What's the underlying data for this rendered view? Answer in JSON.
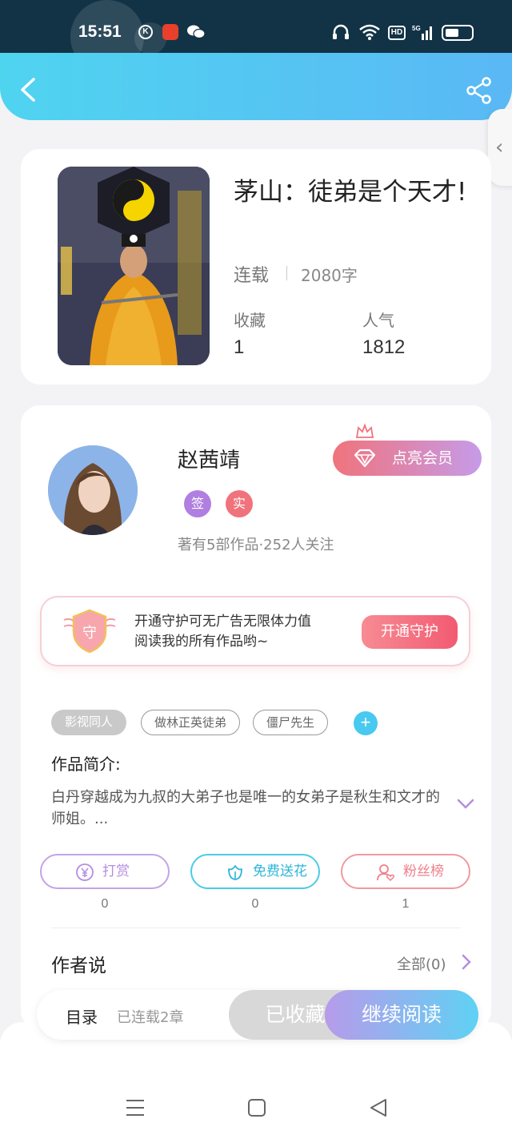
{
  "status_bar": {
    "time": "15:51",
    "k_badge": "K",
    "hd_label": "HD",
    "signal_label": "5G"
  },
  "book": {
    "title": "茅山：徒弟是个天才!",
    "status": "连载",
    "words": "2080字",
    "stats": [
      {
        "label": "收藏",
        "value": "1"
      },
      {
        "label": "人气",
        "value": "1812"
      }
    ]
  },
  "author": {
    "name": "赵茜靖",
    "badges": [
      "签",
      "实"
    ],
    "meta": "著有5部作品·252人关注",
    "vip_button": "点亮会员"
  },
  "guard": {
    "icon_text": "守",
    "line1": "开通守护可无广告无限体力值",
    "line2": "阅读我的所有作品哟~",
    "button": "开通守护"
  },
  "tags": [
    "影视同人",
    "做林正英徒弟",
    "僵尸先生"
  ],
  "intro": {
    "label": "作品简介:",
    "text": "白丹穿越成为九叔的大弟子也是唯一的女弟子是秋生和文才的师姐。..."
  },
  "actions": [
    {
      "label": "打赏",
      "count": "0"
    },
    {
      "label": "免费送花",
      "count": "0"
    },
    {
      "label": "粉丝榜",
      "count": "1"
    }
  ],
  "author_say": {
    "label": "作者说",
    "see_all": "全部(0)"
  },
  "bottom_bar": {
    "toc": "目录",
    "toc_status": "已连载2章",
    "collected": "已收藏",
    "continue": "继续阅读"
  },
  "colors": {
    "header_start": "#4fd4f0",
    "header_end": "#5ab8f5",
    "accent_pink": "#f0737c",
    "accent_purple": "#b07fe0",
    "accent_cyan": "#48c9f0"
  }
}
